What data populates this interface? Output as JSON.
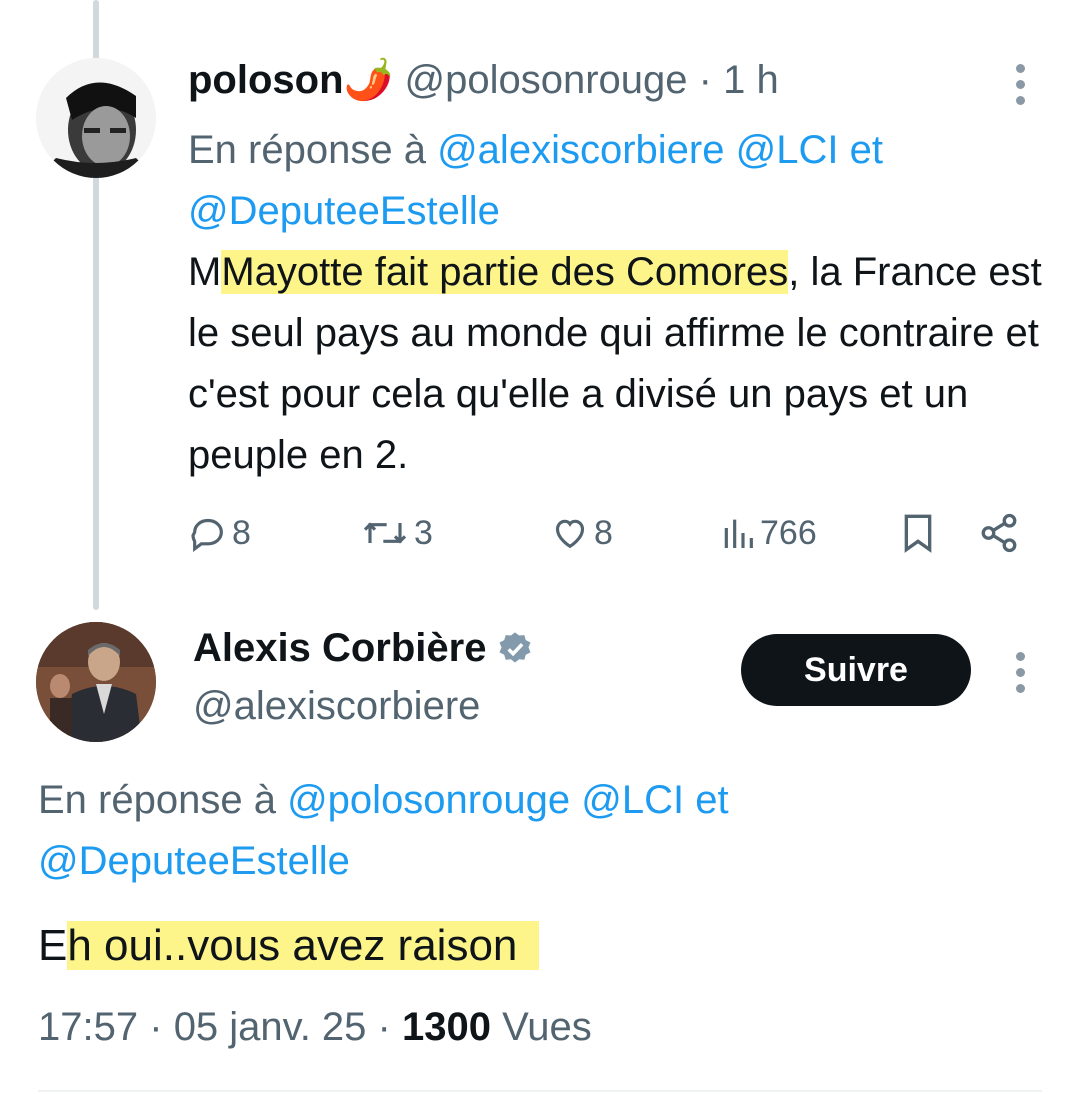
{
  "tweet1": {
    "display_name": "poloson",
    "emoji": "🌶️",
    "handle": "@polosonrouge",
    "separator": "·",
    "time": "1 h",
    "reply_prefix": "En réponse à",
    "reply_mentions": [
      "@alexiscorbiere",
      "@LCI"
    ],
    "reply_and": "et",
    "reply_mention_last": "@DeputeeEstelle",
    "text_highlighted": "Mayotte fait partie des Comores",
    "text_rest": ", la France est le seul pays au monde qui affirme le contraire et c'est pour cela qu'elle a divisé un pays et un peuple en 2.",
    "stats": {
      "replies": "8",
      "reposts": "3",
      "likes": "8",
      "views": "766"
    }
  },
  "tweet2": {
    "display_name": "Alexis Corbière",
    "handle": "@alexiscorbiere",
    "follow_label": "Suivre",
    "reply_prefix": "En réponse à",
    "reply_mentions": [
      "@polosonrouge",
      "@LCI"
    ],
    "reply_and": "et",
    "reply_mention_last": "@DeputeeEstelle",
    "text_first": "E",
    "text_highlighted": "h oui..vous avez raison",
    "time": "17:57",
    "separator": "·",
    "date": "05 janv. 25",
    "views_count": "1300",
    "views_label": "Vues"
  },
  "icons": {
    "reply": "comment-icon",
    "repost": "repost-icon",
    "like": "heart-icon",
    "views": "views-chart-icon",
    "bookmark": "bookmark-icon",
    "share": "share-icon",
    "more": "more-vertical-icon",
    "verified": "verified-badge-icon"
  },
  "colors": {
    "link": "#1d9bf0",
    "muted": "#536471",
    "highlight": "#fdf58a",
    "follow_bg": "#0f1419"
  }
}
